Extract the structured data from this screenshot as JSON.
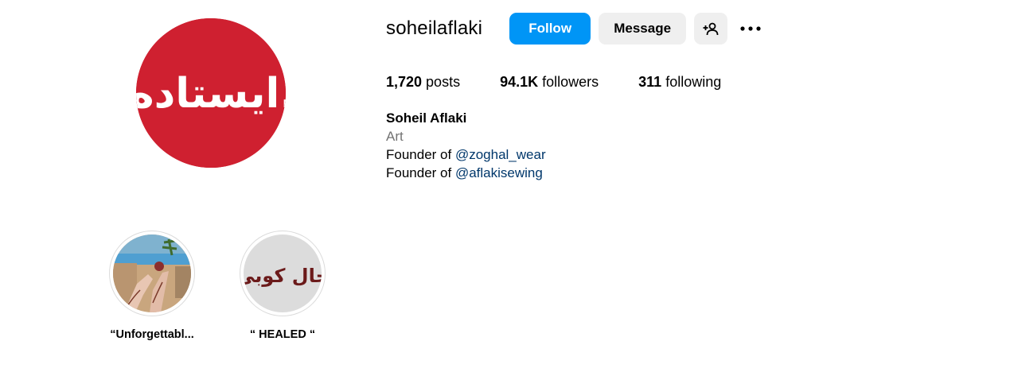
{
  "profile": {
    "username": "soheilaflaki",
    "avatar_text": "ایستاده.",
    "avatar_color": "#cf2030",
    "buttons": {
      "follow": "Follow",
      "message": "Message",
      "suggest_icon": "add-person-icon",
      "more_icon": "more-options-icon"
    },
    "stats": {
      "posts_count": "1,720",
      "posts_label": " posts",
      "followers_count": "94.1K",
      "followers_label": " followers",
      "following_count": "311",
      "following_label": " following"
    },
    "bio": {
      "full_name": "Soheil Aflaki",
      "category": "Art",
      "line1_prefix": "Founder of ",
      "line1_mention": "@zoghal_wear",
      "line2_prefix": "Founder of ",
      "line2_mention": "@aflakisewing"
    },
    "accent_color": "#0095f6"
  },
  "highlights": [
    {
      "label": "“Unforgettabl...",
      "image": "hands-photo"
    },
    {
      "label": "“ HEALED “",
      "image_text": "خال کوبی"
    }
  ]
}
